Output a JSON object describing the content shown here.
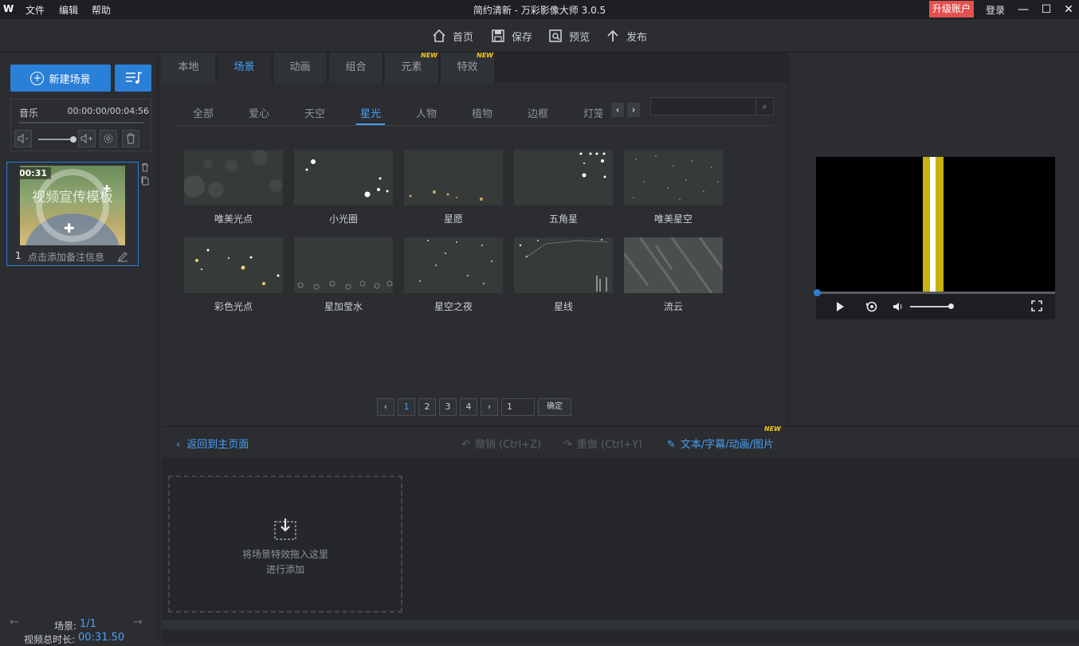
{
  "app": {
    "logo": "W",
    "title": "简约清新 - 万彩影像大师 3.0.5",
    "menu": [
      "文件",
      "编辑",
      "帮助"
    ],
    "upgrade_label": "升级账户",
    "login_label": "登录",
    "minimize_symbol": "—",
    "maximize_symbol": "☐",
    "close_symbol": "✕"
  },
  "toolbar": {
    "home": "首页",
    "save": "保存",
    "preview": "预览",
    "publish": "发布"
  },
  "left": {
    "new_scene": "新建场景",
    "music_label": "音乐",
    "music_time": "00:00:00/00:04:56",
    "scene": {
      "duration": "00:31",
      "thumb_text": "视频宣传模板",
      "index": "1",
      "note_placeholder": "点击添加备注信息"
    },
    "footer": {
      "scene_label": "场景:",
      "scene_value": "1/1",
      "total_label": "视频总时长:",
      "total_value": "00:31.50"
    }
  },
  "library": {
    "tabs": [
      {
        "label": "本地",
        "new": false
      },
      {
        "label": "场景",
        "new": false,
        "active": true
      },
      {
        "label": "动画",
        "new": false
      },
      {
        "label": "组合",
        "new": false
      },
      {
        "label": "元素",
        "new": true
      },
      {
        "label": "特效",
        "new": true
      }
    ],
    "new_badge": "NEW",
    "categories": [
      "全部",
      "爱心",
      "天空",
      "星光",
      "人物",
      "植物",
      "边框",
      "灯笼"
    ],
    "active_category": "星光",
    "items": [
      {
        "name": "唯美光点"
      },
      {
        "name": "小光圈"
      },
      {
        "name": "星愿"
      },
      {
        "name": "五角星"
      },
      {
        "name": "唯美星空"
      },
      {
        "name": "彩色光点"
      },
      {
        "name": "星加莹水"
      },
      {
        "name": "星空之夜"
      },
      {
        "name": "星线"
      },
      {
        "name": "流云"
      }
    ],
    "pager": {
      "pages": [
        "1",
        "2",
        "3",
        "4"
      ],
      "current_page": "1",
      "input_value": "1",
      "confirm_label": "确定"
    }
  },
  "editbar": {
    "back_label": "返回到主页面",
    "undo_label": "撤销 (Ctrl+Z)",
    "redo_label": "重做 (Ctrl+Y)",
    "text_label": "文本/字幕/动画/图片",
    "new_badge": "NEW"
  },
  "dropzone": {
    "line1": "将场景特效拖入这里",
    "line2": "进行添加"
  },
  "colors": {
    "accent": "#2a7fd6",
    "link": "#49a0f5",
    "upgrade": "#e25151",
    "new_badge": "#f5c518"
  }
}
